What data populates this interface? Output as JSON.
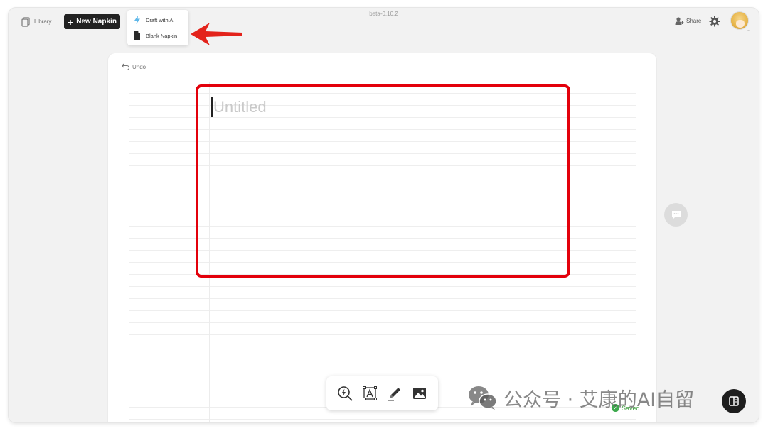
{
  "header": {
    "version": "beta-0.10.2",
    "library_label": "Library",
    "new_button_label": "New Napkin",
    "share_label": "Share"
  },
  "new_menu": {
    "items": [
      {
        "label": "Draft with AI",
        "icon": "lightning-icon"
      },
      {
        "label": "Blank Napkin",
        "icon": "document-icon"
      }
    ]
  },
  "editor": {
    "undo_label": "Undo",
    "title_placeholder": "Untitled"
  },
  "footer": {
    "saved_label": "Saved"
  },
  "toolbar": {
    "tools": [
      "generate-visual-icon",
      "text-box-icon",
      "pen-icon",
      "image-icon"
    ]
  },
  "watermark": {
    "text": "公众号 · 艾康的AI自留"
  },
  "colors": {
    "new_button_bg": "#222222",
    "highlight": "#e3000b",
    "ai_icon": "#5fb8ea",
    "saved": "#3da94d"
  }
}
